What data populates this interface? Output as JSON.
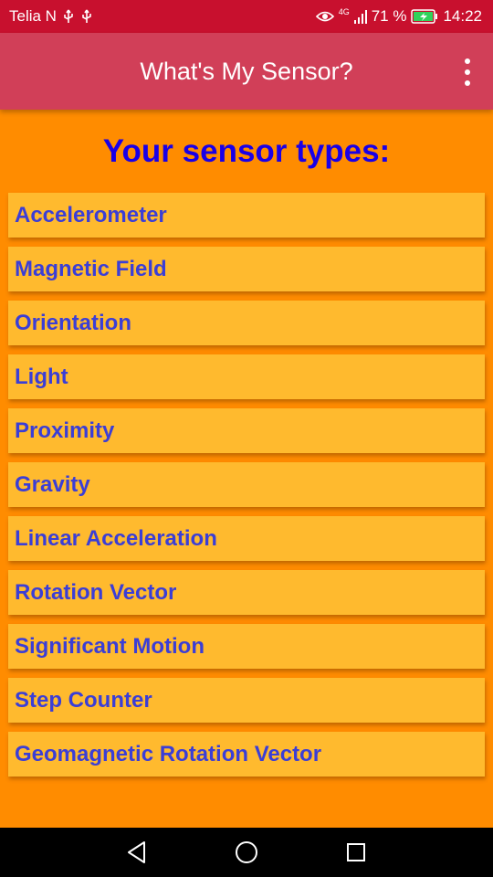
{
  "status_bar": {
    "carrier": "Telia N",
    "network": "4G",
    "battery_percent": "71 %",
    "time": "14:22",
    "left_icons": [
      "usb-icon",
      "usb-icon"
    ],
    "right_icons": [
      "eye-icon",
      "signal-icon",
      "battery-charging-icon"
    ]
  },
  "app_bar": {
    "title": "What's My Sensor?",
    "menu_icon": "more-vert-icon"
  },
  "main": {
    "heading": "Your sensor types:",
    "sensors": [
      "Accelerometer",
      "Magnetic Field",
      "Orientation",
      "Light",
      "Proximity",
      "Gravity",
      "Linear Acceleration",
      "Rotation Vector",
      "Significant Motion",
      "Step Counter",
      "Geomagnetic Rotation Vector"
    ]
  },
  "nav_bar": {
    "icons": [
      "back-icon",
      "home-icon",
      "recents-icon"
    ]
  },
  "colors": {
    "status_bar": "#c8102e",
    "app_bar": "#d13f58",
    "background": "#ff8c00",
    "item_background": "#ffba2e",
    "item_text": "#3b3ed6",
    "heading_text": "#1a00e6"
  }
}
